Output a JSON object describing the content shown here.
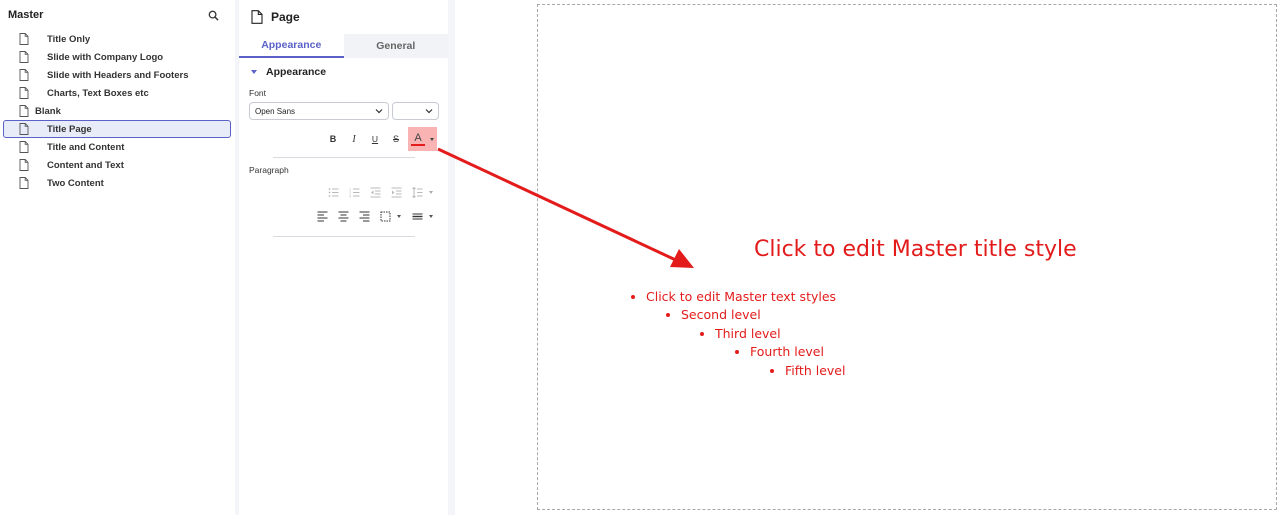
{
  "master": {
    "title": "Master",
    "items": [
      {
        "label": "Title Only",
        "level": "child"
      },
      {
        "label": "Slide with Company Logo",
        "level": "child"
      },
      {
        "label": "Slide with Headers and Footers",
        "level": "child"
      },
      {
        "label": "Charts, Text Boxes etc",
        "level": "child"
      },
      {
        "label": "Blank",
        "level": "top"
      },
      {
        "label": "Title Page",
        "level": "child",
        "selected": true
      },
      {
        "label": "Title and Content",
        "level": "child"
      },
      {
        "label": "Content and Text",
        "level": "child"
      },
      {
        "label": "Two Content",
        "level": "child"
      }
    ]
  },
  "props": {
    "title": "Page",
    "tabs": [
      {
        "label": "Appearance",
        "active": true
      },
      {
        "label": "General",
        "active": false
      }
    ],
    "section_title": "Appearance",
    "font_label": "Font",
    "font_family": "Open Sans",
    "font_size": "",
    "format": {
      "bold": "B",
      "italic": "I",
      "underline": "U",
      "strike": "S",
      "color": "A"
    },
    "paragraph_label": "Paragraph"
  },
  "slide": {
    "title": "Click to edit Master title style",
    "levels": [
      "Click to edit Master text styles",
      "Second level",
      "Third level",
      "Fourth level",
      "Fifth level"
    ]
  },
  "colors": {
    "accent": "#5a62c8",
    "placeholder_text": "#e31b1b",
    "annotation_arrow": "#e31b1b",
    "highlight": "#f9b3b3"
  },
  "icons": {
    "search": "search-icon",
    "document": "document-icon",
    "page": "page-icon",
    "chevron": "chevron-down-icon"
  }
}
